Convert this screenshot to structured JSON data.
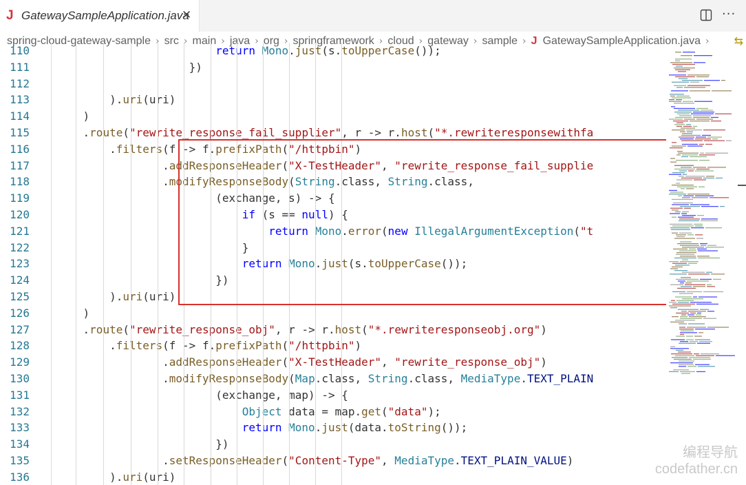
{
  "tab": {
    "title": "GatewaySampleApplication.java",
    "icon": "java-file-icon",
    "close_icon": "close-icon"
  },
  "actions": {
    "split": "split-editor-icon",
    "more": "more-actions-icon"
  },
  "breadcrumb": [
    "spring-cloud-gateway-sample",
    "src",
    "main",
    "java",
    "org",
    "springframework",
    "cloud",
    "gateway",
    "sample",
    "GatewaySampleApplication.java"
  ],
  "code_lines": [
    {
      "n": "110",
      "text": "                                        return Mono.just(s.toUpperCase());"
    },
    {
      "n": "111",
      "text": "                                    })"
    },
    {
      "n": "112",
      "text": ""
    },
    {
      "n": "113",
      "text": "                        ).uri(uri)"
    },
    {
      "n": "114",
      "text": "                    )"
    },
    {
      "n": "115",
      "text": "                    .route(\"rewrite_response_fail_supplier\", r -> r.host(\"*.rewriteresponsewithfa"
    },
    {
      "n": "116",
      "text": "                        .filters(f -> f.prefixPath(\"/httpbin\")"
    },
    {
      "n": "117",
      "text": "                                .addResponseHeader(\"X-TestHeader\", \"rewrite_response_fail_supplie"
    },
    {
      "n": "118",
      "text": "                                .modifyResponseBody(String.class, String.class,"
    },
    {
      "n": "119",
      "text": "                                        (exchange, s) -> {"
    },
    {
      "n": "120",
      "text": "                                            if (s == null) {"
    },
    {
      "n": "121",
      "text": "                                                return Mono.error(new IllegalArgumentException(\"t"
    },
    {
      "n": "122",
      "text": "                                            }"
    },
    {
      "n": "123",
      "text": "                                            return Mono.just(s.toUpperCase());"
    },
    {
      "n": "124",
      "text": "                                        })"
    },
    {
      "n": "125",
      "text": "                        ).uri(uri)"
    },
    {
      "n": "126",
      "text": "                    )"
    },
    {
      "n": "127",
      "text": "                    .route(\"rewrite_response_obj\", r -> r.host(\"*.rewriteresponseobj.org\")"
    },
    {
      "n": "128",
      "text": "                        .filters(f -> f.prefixPath(\"/httpbin\")"
    },
    {
      "n": "129",
      "text": "                                .addResponseHeader(\"X-TestHeader\", \"rewrite_response_obj\")"
    },
    {
      "n": "130",
      "text": "                                .modifyResponseBody(Map.class, String.class, MediaType.TEXT_PLAIN"
    },
    {
      "n": "131",
      "text": "                                        (exchange, map) -> {"
    },
    {
      "n": "132",
      "text": "                                            Object data = map.get(\"data\");"
    },
    {
      "n": "133",
      "text": "                                            return Mono.just(data.toString());"
    },
    {
      "n": "134",
      "text": "                                        })"
    },
    {
      "n": "135",
      "text": "                                .setResponseHeader(\"Content-Type\", MediaType.TEXT_PLAIN_VALUE)"
    },
    {
      "n": "136",
      "text": "                        ).uri(uri)"
    }
  ],
  "watermark": {
    "line1": "编程导航",
    "line2": "codefather.cn"
  },
  "colors": {
    "highlight_border": "#d9302b",
    "keyword": "#0000ff",
    "string": "#a31515",
    "function": "#795e26",
    "type": "#267f99",
    "line_number": "#237893"
  }
}
